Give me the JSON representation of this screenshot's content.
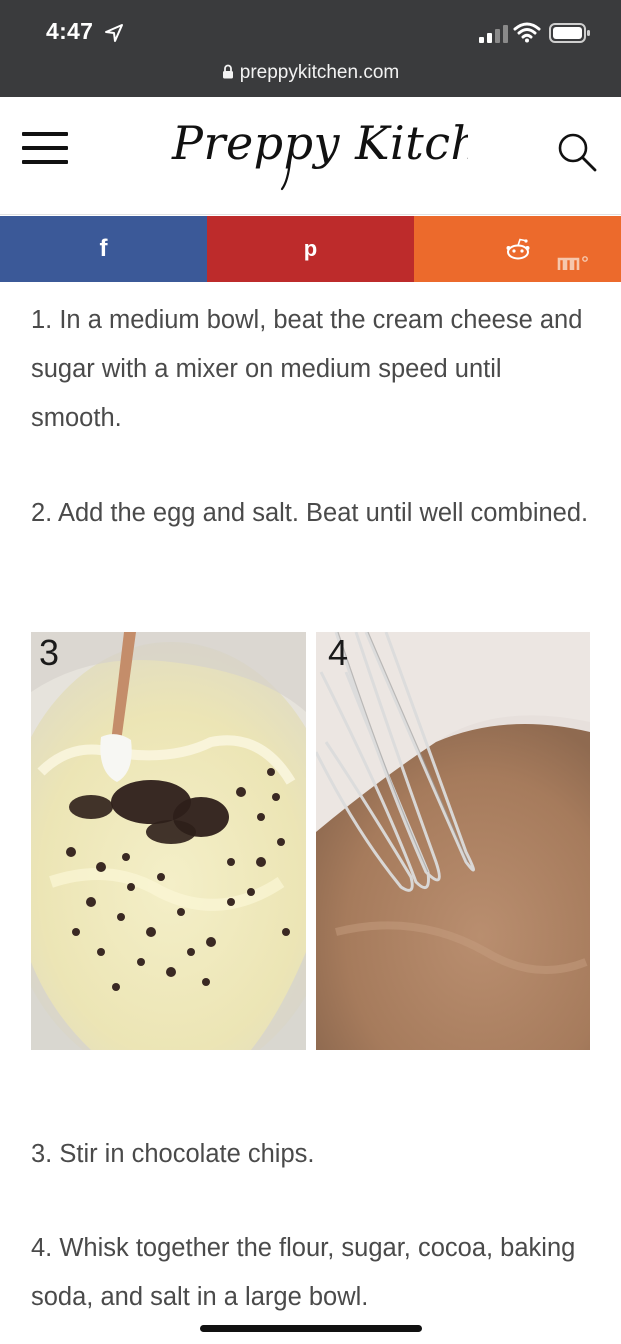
{
  "status_bar": {
    "time": "4:47",
    "url": "preppykitchen.com"
  },
  "header": {
    "logo_text": "Preppy Kitchen"
  },
  "share_bar": {
    "facebook_glyph": "f",
    "pinterest_glyph": "p",
    "reddit_glyph": "reddit-icon",
    "colors": {
      "facebook": "#3b5998",
      "pinterest": "#bd2b2b",
      "reddit": "#ec6a2c"
    }
  },
  "steps": [
    {
      "text": "1. In a medium bowl, beat the cream cheese and sugar with a mixer on medium speed until smooth."
    },
    {
      "text": "2. Add the egg and salt. Beat until well combined."
    },
    {
      "text": "3. Stir in chocolate chips."
    },
    {
      "text": "4. Whisk together the flour, sugar, cocoa, baking soda, and salt in a large bowl."
    }
  ],
  "photos": [
    {
      "number": "3"
    },
    {
      "number": "4"
    }
  ]
}
